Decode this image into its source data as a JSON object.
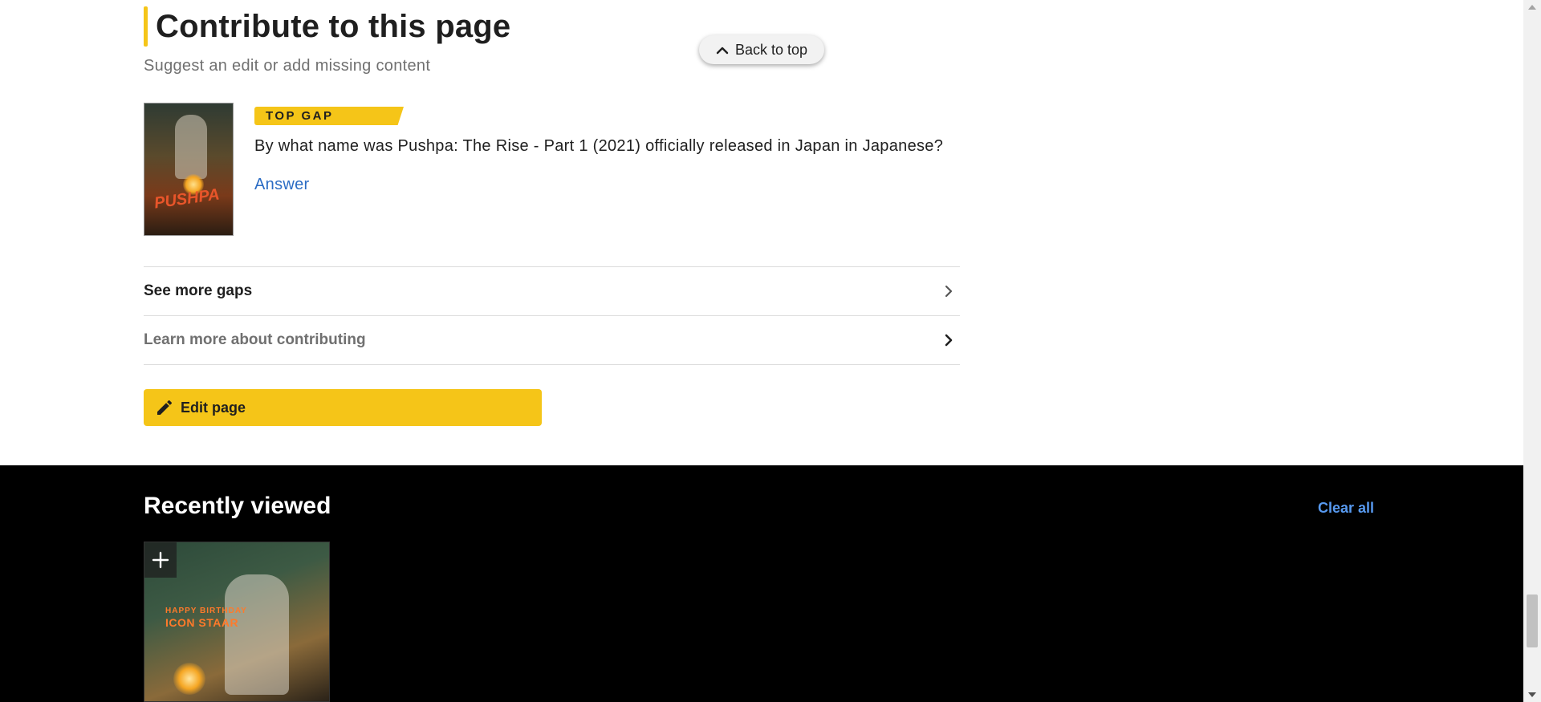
{
  "contribute": {
    "title": "Contribute to this page",
    "subtitle": "Suggest an edit or add missing content",
    "back_to_top": "Back to top",
    "gap": {
      "badge": "TOP GAP",
      "question": "By what name was Pushpa: The Rise - Part 1 (2021) officially released in Japan in Japanese?",
      "answer_label": "Answer",
      "poster_word": "PUSHPA"
    },
    "rows": [
      {
        "label": "See more gaps",
        "color": "#1f1f1f"
      },
      {
        "label": "Learn more about contributing",
        "color": "#707070"
      }
    ],
    "edit_button": "Edit page"
  },
  "recently_viewed": {
    "title": "Recently viewed",
    "clear_all": "Clear all",
    "items": [
      {
        "line1": "HAPPY BIRTHDAY",
        "line2": "ICON STAAR",
        "add_icon": "plus-icon"
      }
    ]
  },
  "colors": {
    "accent": "#f5c518",
    "link": "#2b6cc4",
    "dark_link": "#5799ef",
    "dark_bg": "#000000"
  }
}
